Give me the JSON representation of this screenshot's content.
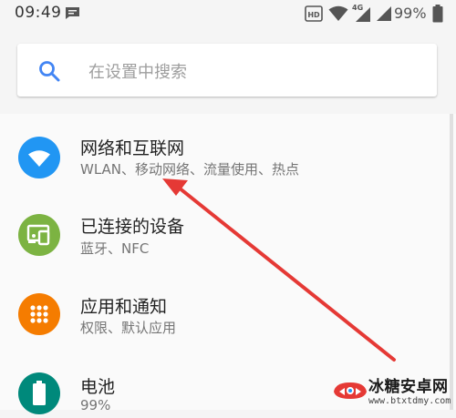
{
  "status_bar": {
    "time": "09:49",
    "battery_percent": "99%",
    "network_label": "4G",
    "icons": [
      "message-icon",
      "hd-icon",
      "wifi-icon",
      "cell-4g-icon",
      "cell-signal-icon",
      "battery-icon"
    ]
  },
  "search": {
    "placeholder": "在设置中搜索",
    "icon": "search-icon"
  },
  "settings_items": [
    {
      "title": "网络和互联网",
      "subtitle": "WLAN、移动网络、流量使用、热点",
      "icon": "wifi-icon",
      "color": "#2196f3"
    },
    {
      "title": "已连接的设备",
      "subtitle": "蓝牙、NFC",
      "icon": "devices-icon",
      "color": "#7cb342"
    },
    {
      "title": "应用和通知",
      "subtitle": "权限、默认应用",
      "icon": "apps-grid-icon",
      "color": "#f57c00"
    },
    {
      "title": "电池",
      "subtitle": "99%",
      "icon": "battery-icon",
      "color": "#00897b"
    }
  ],
  "annotation": {
    "arrow_color": "#e53935"
  },
  "watermark": {
    "title": "冰糖安卓网",
    "url": "www.btxtdmy.com"
  }
}
